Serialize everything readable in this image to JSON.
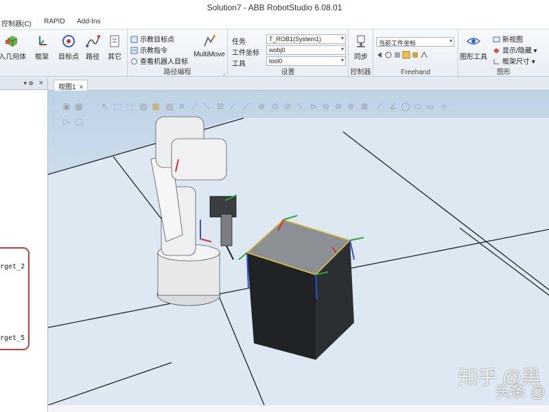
{
  "window": {
    "title": "Solution7 - ABB RobotStudio 6.08.01"
  },
  "menu": {
    "tabs": [
      "控制器(C)",
      "RAPID",
      "Add-Ins"
    ]
  },
  "ribbon": {
    "buttons_left": [
      {
        "label": "入几何体",
        "icon": "import-geometry-icon"
      },
      {
        "label": "框架",
        "icon": "frame-icon"
      },
      {
        "label": "目标点",
        "icon": "target-icon"
      },
      {
        "label": "路径",
        "icon": "path-icon"
      },
      {
        "label": "其它",
        "icon": "other-icon"
      }
    ],
    "path_small": [
      "示教目标点",
      "示教指令",
      "查看机器人目标"
    ],
    "multimove": "MultiMove",
    "group_path": "路径编程",
    "settings": {
      "task_label": "任务",
      "task_value": "T_ROB1(System1)",
      "wobj_label": "工件坐标",
      "wobj_value": "wobj0",
      "tool_label": "工具",
      "tool_value": "tool0",
      "group": "设置"
    },
    "controller": {
      "sync_label": "同步",
      "group": "控制器"
    },
    "freehand": {
      "frame_value": "当前工件坐标",
      "group": "Freehand"
    },
    "graphics": {
      "tools_label": "图形工具",
      "new_view": "新视图",
      "show_hide": "显示/隐藏",
      "frame_size": "框架尺寸",
      "group": "图形"
    }
  },
  "left_panel": {
    "pin": "▾ ⊕",
    "close": "×",
    "items": [
      "rget_2",
      "rget_5"
    ]
  },
  "doc_tab": {
    "label": "视图1",
    "close": "×"
  },
  "watermark": {
    "line1": "知乎 @黑",
    "line2": "头条 @"
  },
  "colors": {
    "ribbon_bg": "#eef2f8",
    "viewport_top": "#bfd3e6",
    "highlight": "#d23a3a",
    "box_dark": "#1f2326",
    "box_top": "#8c9094"
  }
}
